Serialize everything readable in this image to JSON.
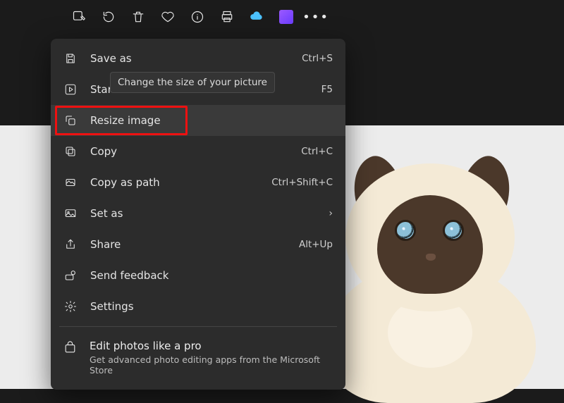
{
  "toolbar": {
    "items": [
      "edit-image",
      "rotate",
      "delete",
      "favorite",
      "info",
      "print",
      "cloud",
      "clipchamp",
      "more"
    ]
  },
  "menu": {
    "save_as": {
      "label": "Save as",
      "shortcut": "Ctrl+S"
    },
    "slideshow": {
      "label": "Start",
      "shortcut": "F5"
    },
    "resize": {
      "label": "Resize image",
      "shortcut": ""
    },
    "copy": {
      "label": "Copy",
      "shortcut": "Ctrl+C"
    },
    "copy_as_path": {
      "label": "Copy as path",
      "shortcut": "Ctrl+Shift+C"
    },
    "set_as": {
      "label": "Set as",
      "shortcut": ""
    },
    "share": {
      "label": "Share",
      "shortcut": "Alt+Up"
    },
    "feedback": {
      "label": "Send feedback",
      "shortcut": ""
    },
    "settings": {
      "label": "Settings",
      "shortcut": ""
    }
  },
  "promo": {
    "title": "Edit photos like a pro",
    "subtitle": "Get advanced photo editing apps from the Microsoft Store"
  },
  "tooltip": "Change the size of your picture"
}
